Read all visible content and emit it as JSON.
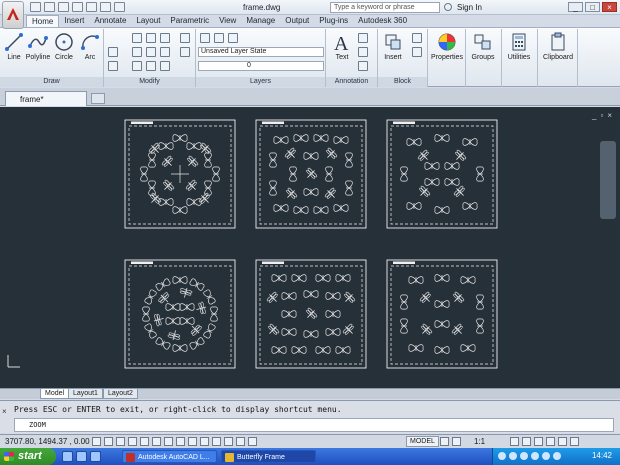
{
  "title_bar": {
    "document_title": "frame.dwg",
    "search_placeholder": "Type a keyword or phrase",
    "sign_in": "Sign In"
  },
  "ribbon_tabs": [
    "Home",
    "Insert",
    "Annotate",
    "Layout",
    "Parametric",
    "View",
    "Manage",
    "Output",
    "Plug-ins",
    "Autodesk 360"
  ],
  "ribbon": {
    "draw": {
      "label": "Draw",
      "tools": [
        "Line",
        "Polyline",
        "Circle",
        "Arc"
      ]
    },
    "modify": {
      "label": "Modify"
    },
    "layers": {
      "label": "Layers",
      "layer_state": "Unsaved Layer State",
      "current_layer": "0"
    },
    "annotation": {
      "label": "Annotation",
      "text_tool": "Text"
    },
    "block": {
      "label": "Block",
      "insert_tool": "Insert"
    },
    "properties": "Properties",
    "groups": "Groups",
    "utilities": "Utilities",
    "clipboard": "Clipboard"
  },
  "file_tabs": {
    "current": "frame*"
  },
  "layout_tabs": [
    "Model",
    "Layout1",
    "Layout2"
  ],
  "command_line": {
    "history": "Press ESC or ENTER to exit, or right-click to display shortcut menu.",
    "prompt": "ZOOM"
  },
  "status_bar": {
    "coordinates": "3707.80, 1494.37 , 0.00",
    "space": "MODEL",
    "scale": "1:1"
  },
  "taskbar": {
    "start_label": "start",
    "tasks": [
      "Autodesk AutoCAD L...",
      "Butterfly Frame"
    ],
    "clock": "14:42"
  },
  "colors": {
    "canvas_bg": "#263039",
    "drawing_lines": "#e6e6e6",
    "taskbar_blue": "#245edb",
    "start_green": "#3c9a30"
  },
  "icons": [
    "app-menu-icon",
    "save-icon",
    "undo-icon",
    "redo-icon",
    "search-icon",
    "user-icon",
    "help-icon",
    "line-icon",
    "polyline-icon",
    "circle-icon",
    "arc-icon",
    "move-icon",
    "rotate-icon",
    "trim-icon",
    "layer-icon",
    "text-icon",
    "insert-block-icon",
    "properties-icon",
    "groups-icon",
    "utilities-icon",
    "clipboard-icon"
  ]
}
